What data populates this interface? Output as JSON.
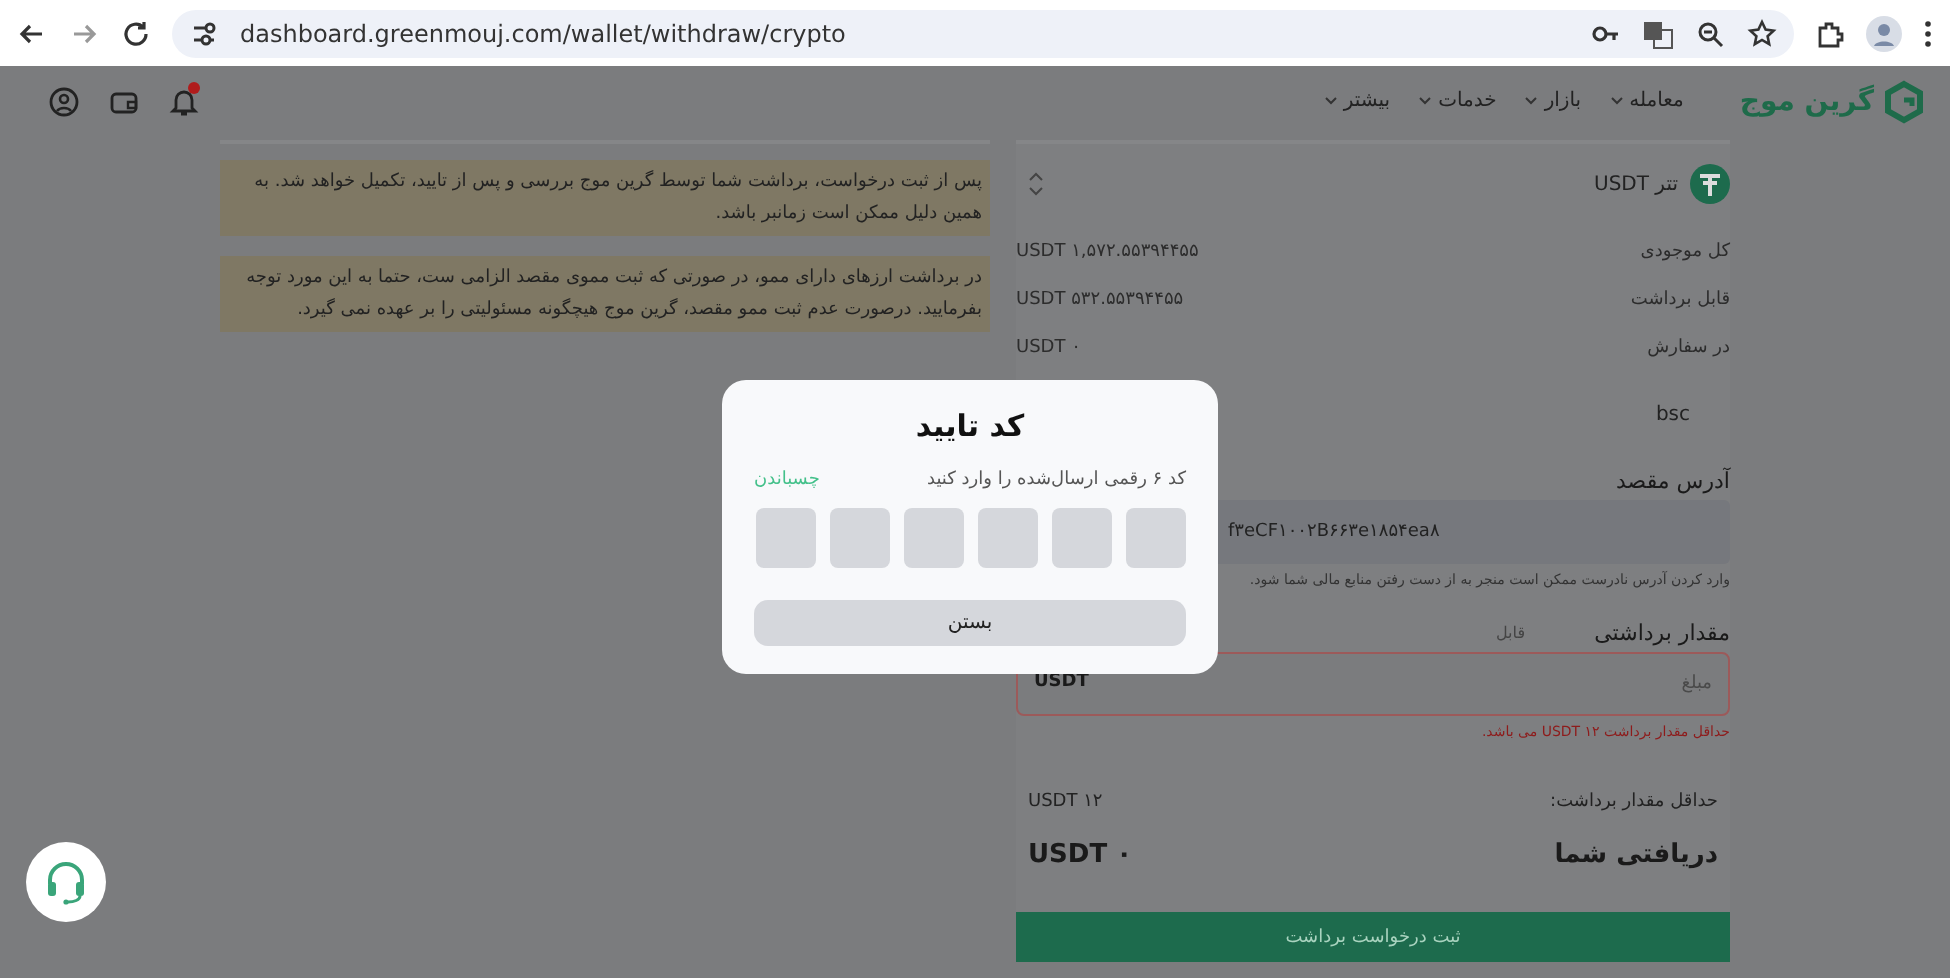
{
  "browser": {
    "url": "dashboard.greenmouj.com/wallet/withdraw/crypto"
  },
  "header": {
    "logo": "گرین موج",
    "nav": [
      {
        "label": "معامله"
      },
      {
        "label": "بازار"
      },
      {
        "label": "خدمات"
      },
      {
        "label": "بیشتر"
      }
    ],
    "notifications_unread": true
  },
  "notes": [
    "پس از ثبت درخواست، برداشت شما توسط گرین موج بررسی و پس از تایید، تکمیل خواهد شد. به همین دلیل ممکن است زمانبر باشد.",
    "در برداشت ارزهای دارای ممو، در صورتی که ثبت مموی مقصد الزامی ست، حتما به این مورد توجه بفرمایید. درصورت عدم ثبت ممو مقصد، گرین موج هیچگونه مسئولیتی را بر عهده نمی گیرد."
  ],
  "form": {
    "coin": "تتر USDT",
    "balances": [
      {
        "label": "کل موجودی",
        "value": "USDT ۱,۵۷۲.۵۵۳۹۴۴۵۵"
      },
      {
        "label": "قابل برداشت",
        "value": "USDT ۵۳۲.۵۵۳۹۴۴۵۵"
      },
      {
        "label": "در سفارش",
        "value": "USDT ۰"
      }
    ],
    "network": "bsc",
    "address_label": "آدرس مقصد",
    "address_value": "f۳eCF۱۰۰۲B۶۶۳e۱۸۵۴ea۸",
    "address_warning": "وارد کردن آدرس نادرست ممکن است منجر به از دست رفتن منابع مالی شما شود.",
    "amount_label": "مقدار برداشتی",
    "amount_side": "قابل",
    "amount_placeholder": "مبلغ",
    "amount_unit": "USDT",
    "amount_invalid": true,
    "amount_error": "حداقل مقدار برداشت ۱۲ USDT می باشد.",
    "min_label": "حداقل مقدار برداشت:",
    "min_value": "USDT ۱۲",
    "receive_label": "دریافتی شما",
    "receive_value": "USDT ۰",
    "submit": "ثبت درخواست برداشت",
    "submit_disabled": true
  },
  "modal": {
    "title": "کد تایید",
    "prompt": "کد ۶ رقمی ارسال‌شده را وارد کنید",
    "paste": "چسباندن",
    "digits": [
      {
        "filled": false
      },
      {
        "filled": false
      },
      {
        "filled": false
      },
      {
        "filled": false
      },
      {
        "filled": false
      },
      {
        "filled": false
      }
    ],
    "close": "بستن"
  }
}
